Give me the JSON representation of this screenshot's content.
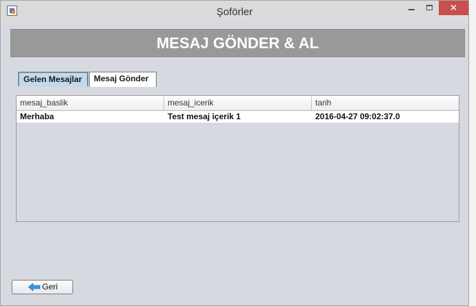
{
  "window": {
    "title": "Şoförler",
    "close_glyph": "✕"
  },
  "header": {
    "title": "MESAJ GÖNDER & AL"
  },
  "tabs": [
    {
      "label": "Gelen Mesajlar",
      "selected": true
    },
    {
      "label": "Mesaj Gönder",
      "selected": false
    }
  ],
  "table": {
    "columns": [
      "mesaj_baslik",
      "mesaj_icerik",
      "tarih"
    ],
    "rows": [
      [
        "Merhaba",
        "Test mesaj içerik 1",
        "2016-04-27 09:02:37.0"
      ]
    ]
  },
  "back_button": {
    "label": "Geri",
    "icon": "arrow-left-icon"
  },
  "colors": {
    "header_bg": "#999999",
    "selected_tab": "#c2d9ee",
    "close_button": "#c7504c",
    "back_arrow": "#3d95d8"
  }
}
